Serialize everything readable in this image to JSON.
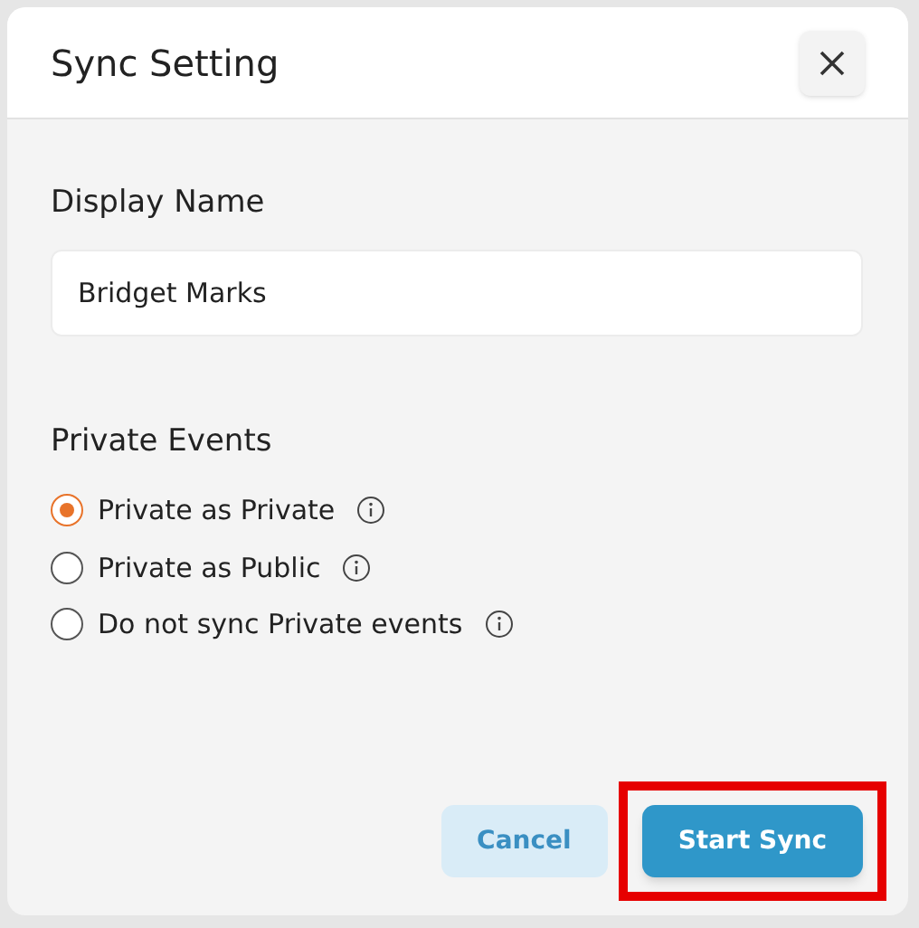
{
  "dialog": {
    "title": "Sync Setting"
  },
  "display_name": {
    "label": "Display Name",
    "value": "Bridget Marks"
  },
  "private_events": {
    "label": "Private Events",
    "options": [
      {
        "label": "Private as Private",
        "selected": true
      },
      {
        "label": "Private as Public",
        "selected": false
      },
      {
        "label": "Do not sync Private events",
        "selected": false
      }
    ]
  },
  "buttons": [
    {
      "label": "Cancel",
      "kind": "secondary",
      "highlighted": false
    },
    {
      "label": "Start Sync",
      "kind": "primary",
      "highlighted": true
    }
  ]
}
